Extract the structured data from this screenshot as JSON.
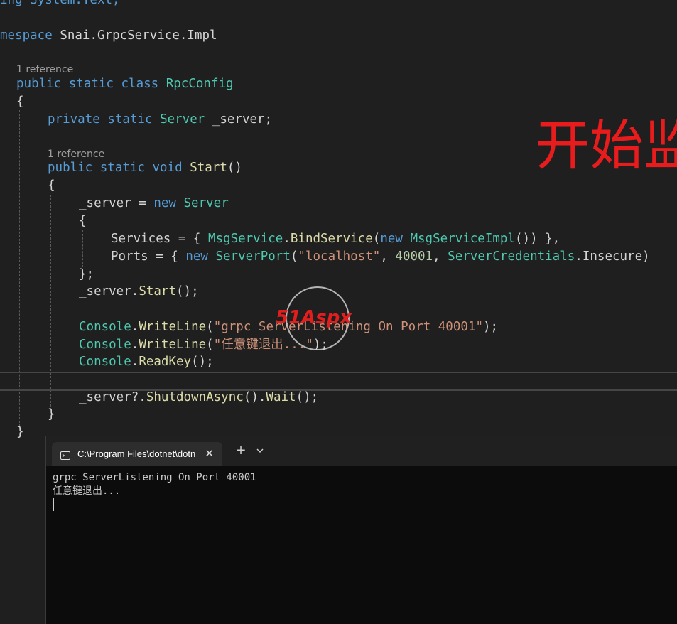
{
  "code": {
    "line1": "ing System.Text;",
    "namespace_kw": "mespace",
    "namespace_name": "Snai.GrpcService.Impl",
    "class_refs": "1 reference",
    "class_kw": "public static class",
    "class_name": "RpcConfig",
    "brace_open": "{",
    "field_kw": "private static",
    "field_type": "Server",
    "field_name": " _server;",
    "method_refs": "1 reference",
    "method_kw": "public static void",
    "method_name": "Start",
    "method_parens": "()",
    "server_assign": "_server = ",
    "new_kw": "new",
    "server_type": "Server",
    "services_label": "Services = { ",
    "msg_service": "MsgService",
    "bind_service": "BindService",
    "msg_impl": "MsgServiceImpl",
    "services_end": "()) },",
    "ports_label": "Ports = { ",
    "server_port": "ServerPort",
    "localhost": "\"localhost\"",
    "port_number": "40001",
    "credentials": "ServerCredentials",
    "insecure": "Insecure)",
    "init_close": "};",
    "server_var": "_server",
    "start_call": "Start",
    "call_end": "();",
    "console": "Console",
    "writeline": "WriteLine",
    "msg1": "\"grpc ServerListening On Port 40001\"",
    "msg2": "\"任意键退出...\"",
    "readkey": "ReadKey",
    "shutdown_var": "_server",
    "shutdown": "ShutdownAsync",
    "wait": "Wait",
    "brace_close": "}"
  },
  "overlay": {
    "text": "开始监"
  },
  "watermark": {
    "text": "51Aspx"
  },
  "terminal": {
    "tab_title": "C:\\Program Files\\dotnet\\dotn",
    "close_glyph": "✕",
    "new_tab_glyph": "+",
    "output": [
      "grpc ServerListening On Port 40001",
      "任意键退出..."
    ]
  },
  "colors": {
    "editor_bg": "#1f1f1f",
    "keyword": "#569cd6",
    "type": "#4ec9b0",
    "method": "#dcdcaa",
    "string": "#ce9178",
    "number": "#b5cea8",
    "overlay_red": "#e81c1c",
    "terminal_bg": "#0c0c0c"
  }
}
